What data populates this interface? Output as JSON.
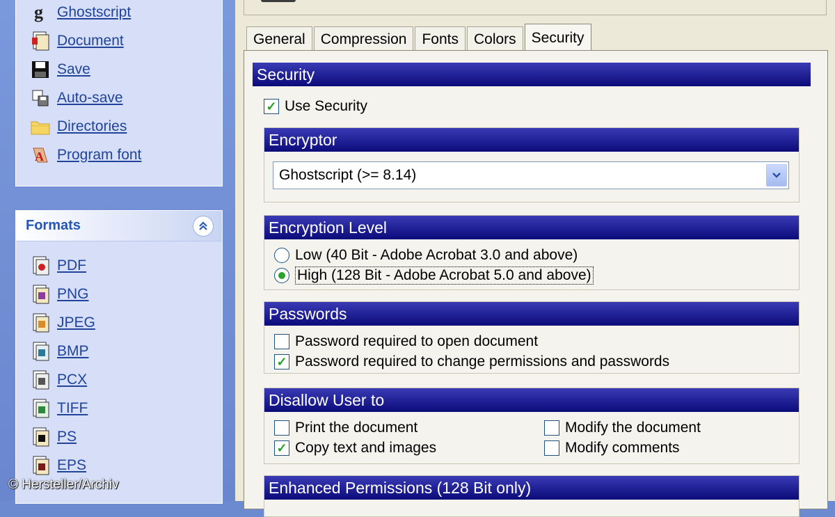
{
  "sidebar": {
    "settings_items": [
      {
        "label": "Ghostscript",
        "icon": "ghostscript-icon"
      },
      {
        "label": "Document",
        "icon": "document-icon"
      },
      {
        "label": "Save",
        "icon": "floppy-disk-icon"
      },
      {
        "label": "Auto-save",
        "icon": "auto-save-icon"
      },
      {
        "label": "Directories",
        "icon": "folder-icon"
      },
      {
        "label": "Program font",
        "icon": "font-icon"
      }
    ],
    "formats": {
      "title": "Formats",
      "items": [
        {
          "label": "PDF",
          "icon": "pdf-file-icon"
        },
        {
          "label": "PNG",
          "icon": "png-file-icon"
        },
        {
          "label": "JPEG",
          "icon": "jpeg-file-icon"
        },
        {
          "label": "BMP",
          "icon": "bmp-file-icon"
        },
        {
          "label": "PCX",
          "icon": "pcx-file-icon"
        },
        {
          "label": "TIFF",
          "icon": "tiff-file-icon"
        },
        {
          "label": "PS",
          "icon": "ps-file-icon"
        },
        {
          "label": "EPS",
          "icon": "eps-file-icon"
        }
      ]
    }
  },
  "tabs": [
    "General",
    "Compression",
    "Fonts",
    "Colors",
    "Security"
  ],
  "active_tab": "Security",
  "security": {
    "title": "Security",
    "use_security": {
      "label": "Use Security",
      "checked": true
    },
    "encryptor": {
      "title": "Encryptor",
      "selected": "Ghostscript (>= 8.14)"
    },
    "encryption_level": {
      "title": "Encryption Level",
      "options": [
        {
          "label": "Low (40 Bit - Adobe Acrobat 3.0 and above)",
          "selected": false
        },
        {
          "label": "High (128 Bit - Adobe Acrobat 5.0 and above)",
          "selected": true
        }
      ]
    },
    "passwords": {
      "title": "Passwords",
      "items": [
        {
          "label": "Password required to open document",
          "checked": false
        },
        {
          "label": "Password required to change permissions and passwords",
          "checked": true
        }
      ]
    },
    "disallow": {
      "title": "Disallow User to",
      "left": [
        {
          "label": "Print the document",
          "checked": false
        },
        {
          "label": "Copy text and images",
          "checked": true
        }
      ],
      "right": [
        {
          "label": "Modify the document",
          "checked": false
        },
        {
          "label": "Modify comments",
          "checked": false
        }
      ]
    },
    "enhanced": {
      "title": "Enhanced Permissions (128 Bit only)"
    }
  },
  "watermark": "© Hersteller/Archiv",
  "colors": {
    "title_bar_dark": "#0b0b7a",
    "title_bar_light": "#3a3ab5",
    "link": "#21449b",
    "check": "#21a121"
  }
}
